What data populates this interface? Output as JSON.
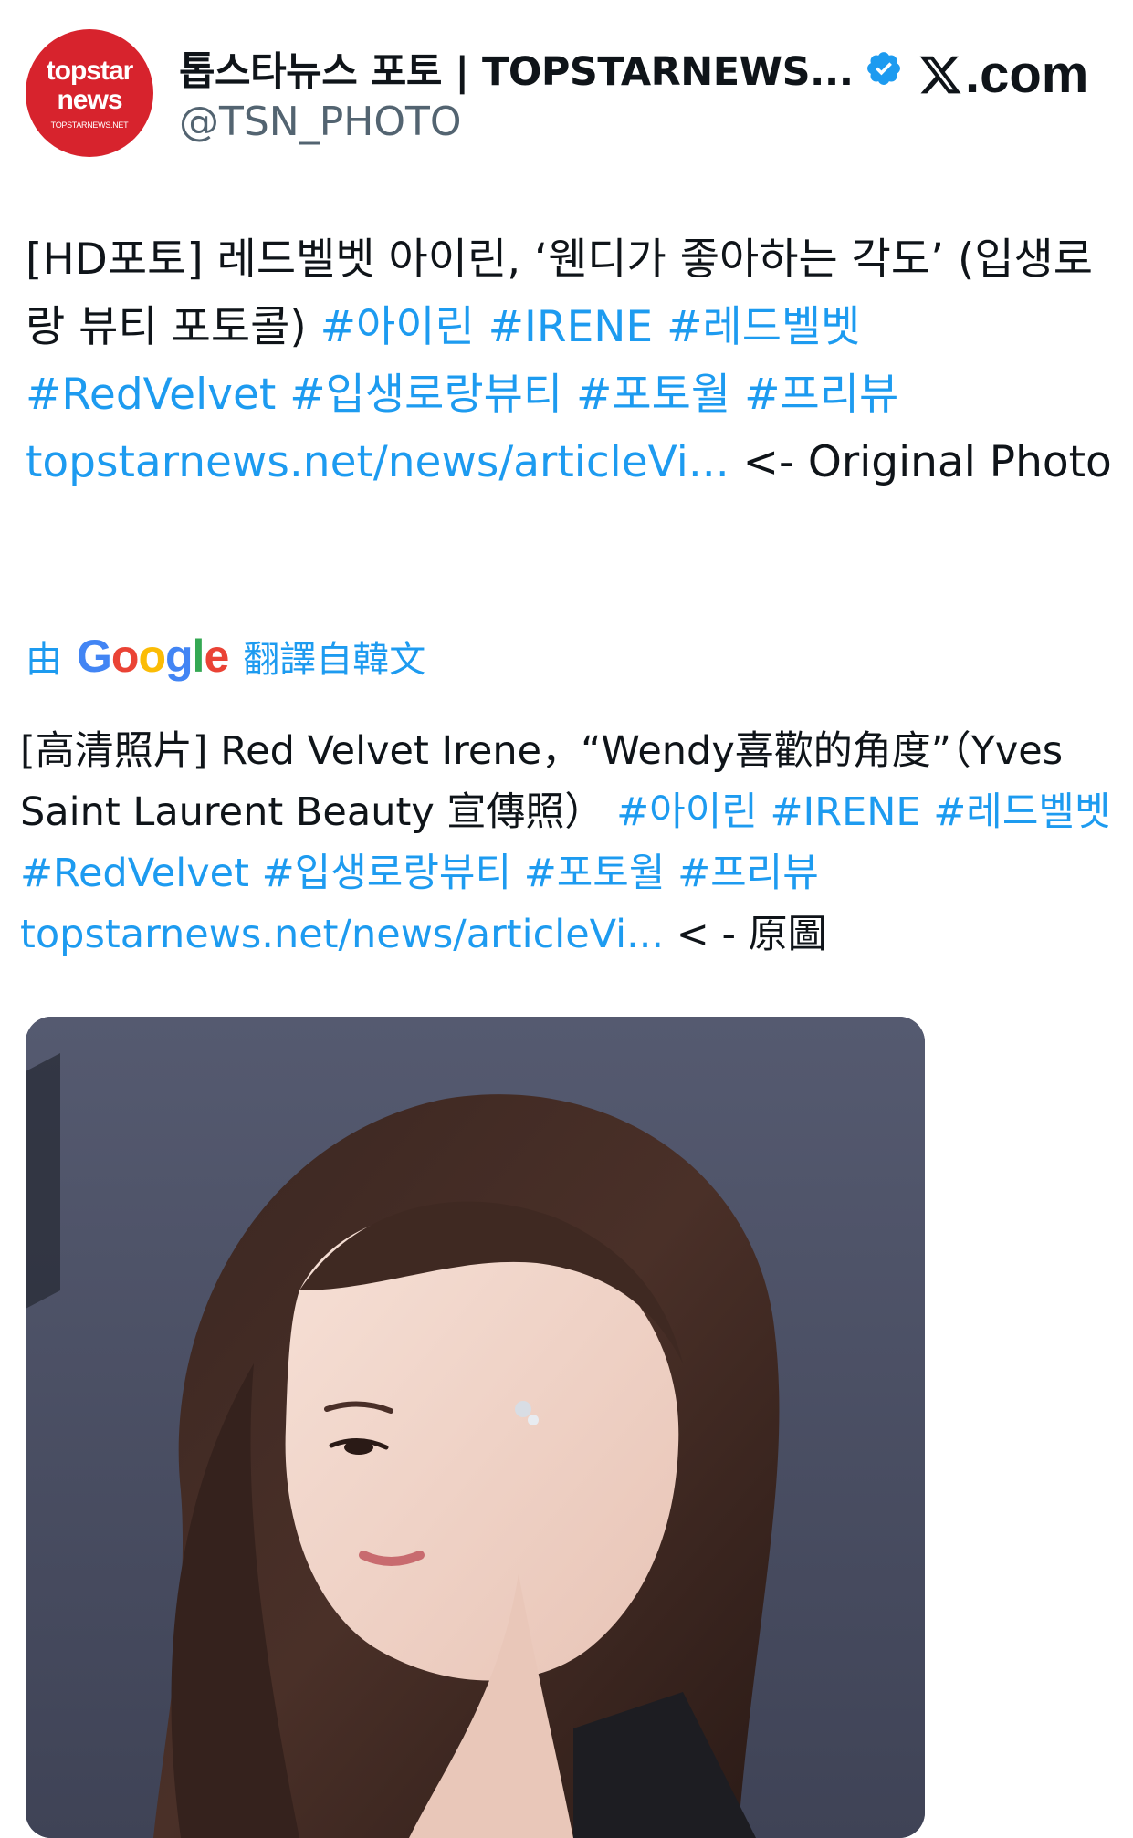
{
  "account": {
    "avatar_line1": "topstar",
    "avatar_line2": "news",
    "avatar_line3": "TOPSTARNEWS.NET",
    "display_name": "톱스타뉴스 포토 | TOPSTARNEWS...",
    "handle": "@TSN_PHOTO",
    "verified_icon": "verified-badge-icon",
    "site_label": ".com",
    "site_icon": "x-logo-icon"
  },
  "tweet": {
    "text_intro": "[HD포토] 레드벨벳 아이린, ‘웬디가 좋아하는 각도’ (입생로랑 뷰티 포토콜) ",
    "hashtags": [
      "#아이린",
      "#IRENE",
      "#레드벨벳",
      "#RedVelvet",
      "#입생로랑뷰티",
      "#포토월",
      "#프리뷰"
    ],
    "link": "topstarnews.net/news/articleVi...",
    "link_suffix": " <- Original Photo"
  },
  "translation": {
    "prefix": "由",
    "google": "Google",
    "suffix": "翻譯自韓文",
    "text_intro": "[高清照片] Red Velvet Irene，“Wendy喜歡的角度”（Yves Saint Laurent Beauty 宣傳照） ",
    "hashtags": [
      "#아이린",
      "#IRENE",
      "#레드벨벳",
      "#RedVelvet",
      "#입생로랑뷰티",
      "#포토월",
      "#프리뷰"
    ],
    "link": "topstarnews.net/news/articleVi...",
    "link_suffix": " < - 原圖"
  },
  "colors": {
    "link": "#1d9bf0",
    "avatar_bg": "#d7232d",
    "photo_backdrop": "#4c5063"
  }
}
